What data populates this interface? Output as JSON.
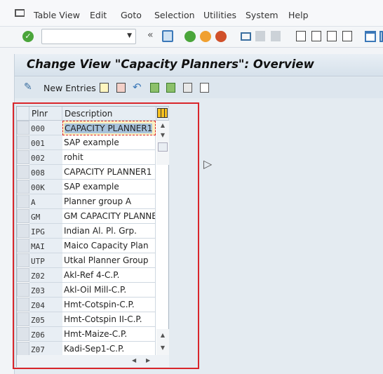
{
  "menu": {
    "items": [
      "Table View",
      "Edit",
      "Goto",
      "Selection",
      "Utilities",
      "System",
      "Help"
    ]
  },
  "toolbar": {
    "command_field": "",
    "icons": [
      "enter-icon",
      "back-icon",
      "exit-icon",
      "cancel-icon",
      "print-icon",
      "find-icon",
      "find-next-icon",
      "first-page-icon",
      "previous-page-icon",
      "next-page-icon",
      "last-page-icon",
      "new-session-icon"
    ]
  },
  "page": {
    "title": "Change View \"Capacity Planners\": Overview"
  },
  "app_toolbar": {
    "new_entries": "New Entries"
  },
  "table": {
    "headers": {
      "plnr": "Plnr",
      "description": "Description"
    },
    "rows": [
      {
        "plnr": "000",
        "description": "CAPACITY PLANNER1"
      },
      {
        "plnr": "001",
        "description": "SAP example"
      },
      {
        "plnr": "002",
        "description": "rohit"
      },
      {
        "plnr": "008",
        "description": "CAPACITY PLANNER1"
      },
      {
        "plnr": "00K",
        "description": "SAP example"
      },
      {
        "plnr": "A",
        "description": "Planner group A"
      },
      {
        "plnr": "GM",
        "description": "GM CAPACITY PLANNER"
      },
      {
        "plnr": "IPG",
        "description": "Indian Al. Pl. Grp."
      },
      {
        "plnr": "MAI",
        "description": "Maico Capacity Plan"
      },
      {
        "plnr": "UTP",
        "description": "Utkal Planner Group"
      },
      {
        "plnr": "Z02",
        "description": "Akl-Ref 4-C.P."
      },
      {
        "plnr": "Z03",
        "description": "Akl-Oil Mill-C.P."
      },
      {
        "plnr": "Z04",
        "description": "Hmt-Cotspin-C.P."
      },
      {
        "plnr": "Z05",
        "description": "Hmt-Cotspin II-C.P."
      },
      {
        "plnr": "Z06",
        "description": "Hmt-Maize-C.P."
      },
      {
        "plnr": "Z07",
        "description": "Kadi-Sep1-C.P."
      }
    ]
  },
  "colors": {
    "highlight": "#d9262b",
    "title_bg": "#d6e1eb"
  }
}
